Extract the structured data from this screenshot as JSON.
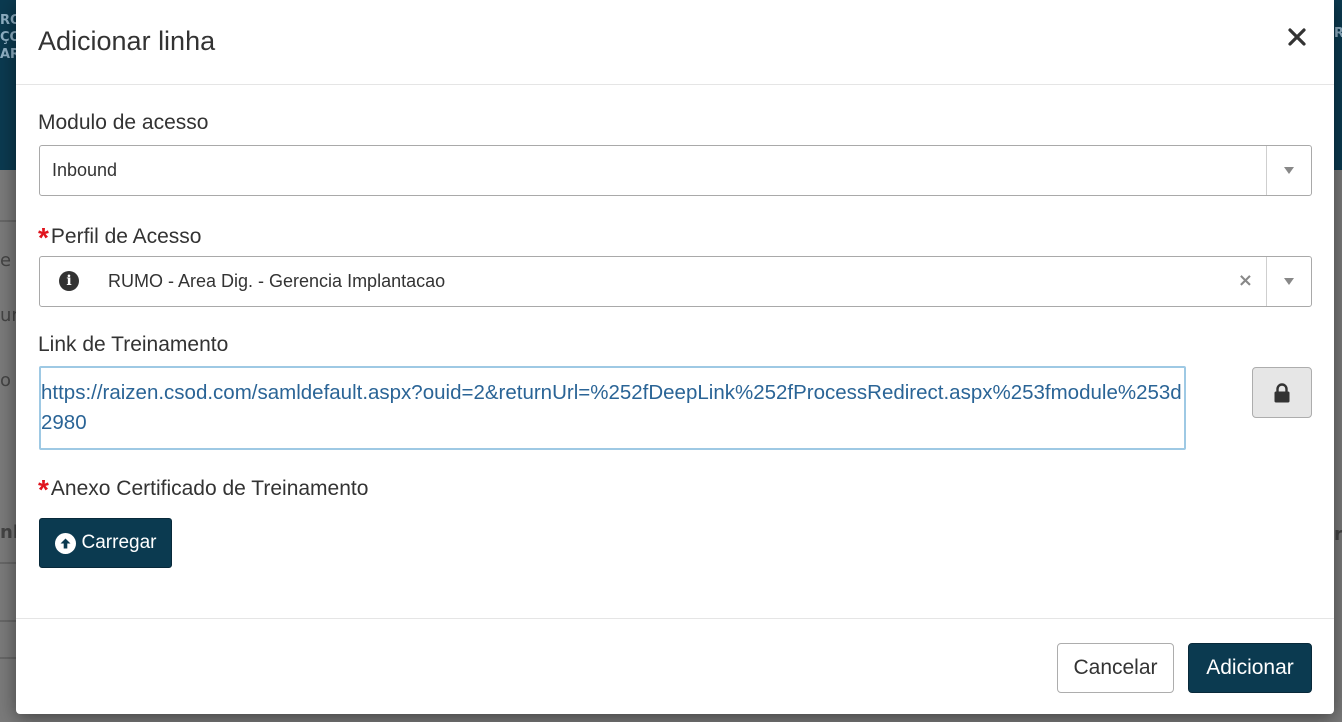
{
  "background": {
    "header_fragments": [
      "RO",
      "ÇO",
      "AR"
    ],
    "header_fragment_right": "R",
    "body_fragments": [
      "e",
      "um",
      "o",
      "nb"
    ],
    "body_fragment_right": "r"
  },
  "modal": {
    "title": "Adicionar linha",
    "close_symbol": "×"
  },
  "form": {
    "modulo": {
      "label": "Modulo de acesso",
      "value": "Inbound"
    },
    "perfil": {
      "required_mark": "*",
      "label": "Perfil de Acesso",
      "info_symbol": "i",
      "value": "RUMO - Area Dig. - Gerencia Implantacao",
      "clear_symbol": "×"
    },
    "link": {
      "label": "Link de Treinamento",
      "value": "https://raizen.csod.com/samldefault.aspx?ouid=2&returnUrl=%252fDeepLink%252fProcessRedirect.aspx%253fmodule%253d2980"
    },
    "anexo": {
      "required_mark": "*",
      "label": "Anexo Certificado de Treinamento",
      "upload_label": "Carregar"
    }
  },
  "footer": {
    "cancel_label": "Cancelar",
    "add_label": "Adicionar"
  },
  "colors": {
    "brand": "#0b3a50",
    "required": "#e0141e",
    "link_text": "#2a6496",
    "focus_border": "#9ec9e4"
  },
  "icons": {
    "close": "close-icon",
    "info": "info-icon",
    "lock": "lock-icon",
    "upload": "upload-circle-icon",
    "dropdown": "chevron-down-icon"
  }
}
